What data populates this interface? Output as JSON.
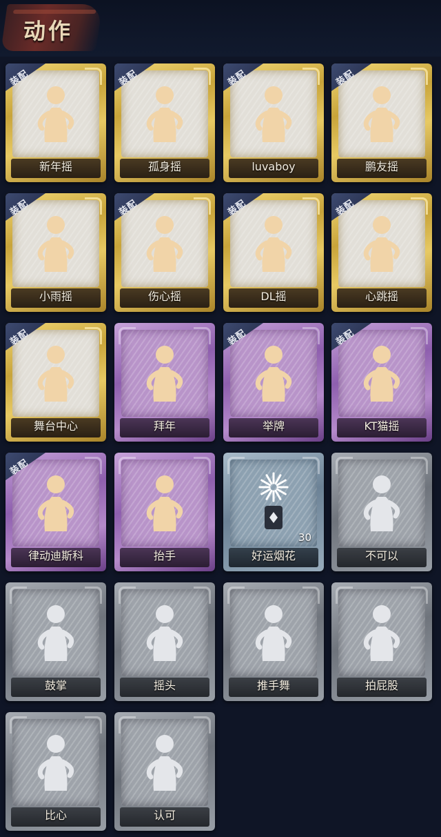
{
  "header": {
    "title": "动作"
  },
  "equip_label": "装配",
  "cards": [
    {
      "label": "新年摇",
      "style": "gold",
      "equipped": true,
      "icon": "new-year-shake-icon"
    },
    {
      "label": "孤身摇",
      "style": "gold",
      "equipped": true,
      "icon": "solo-shake-icon"
    },
    {
      "label": "luvaboy",
      "style": "gold",
      "equipped": true,
      "icon": "luvaboy-icon"
    },
    {
      "label": "鹏友摇",
      "style": "gold",
      "equipped": true,
      "icon": "friend-shake-icon"
    },
    {
      "label": "小雨摇",
      "style": "gold",
      "equipped": true,
      "icon": "light-rain-shake-icon"
    },
    {
      "label": "伤心摇",
      "style": "gold",
      "equipped": true,
      "icon": "heart-hands-icon"
    },
    {
      "label": "DL摇",
      "style": "gold",
      "equipped": true,
      "icon": "dl-shake-icon"
    },
    {
      "label": "心跳摇",
      "style": "gold",
      "equipped": true,
      "icon": "heartbeat-shake-icon"
    },
    {
      "label": "舞台中心",
      "style": "gold",
      "equipped": true,
      "icon": "stage-center-icon"
    },
    {
      "label": "拜年",
      "style": "purple",
      "equipped": false,
      "icon": "new-year-greeting-icon"
    },
    {
      "label": "举牌",
      "style": "purple",
      "equipped": true,
      "icon": "hold-sign-icon"
    },
    {
      "label": "KT猫摇",
      "style": "purple",
      "equipped": true,
      "icon": "kt-cat-shake-icon"
    },
    {
      "label": "律动迪斯科",
      "style": "purple",
      "equipped": true,
      "icon": "rhythm-disco-icon"
    },
    {
      "label": "抬手",
      "style": "purple",
      "equipped": false,
      "icon": "raise-hand-icon"
    },
    {
      "label": "好运烟花",
      "style": "blue",
      "equipped": false,
      "icon": "firework-icon",
      "count": "30"
    },
    {
      "label": "不可以",
      "style": "gray",
      "equipped": false,
      "icon": "finger-wag-icon"
    },
    {
      "label": "鼓掌",
      "style": "gray",
      "equipped": false,
      "icon": "clap-icon"
    },
    {
      "label": "摇头",
      "style": "gray",
      "equipped": false,
      "icon": "shake-head-icon"
    },
    {
      "label": "推手舞",
      "style": "gray",
      "equipped": false,
      "icon": "push-hand-dance-icon"
    },
    {
      "label": "拍屁股",
      "style": "gray",
      "equipped": false,
      "icon": "slap-butt-icon"
    },
    {
      "label": "比心",
      "style": "gray",
      "equipped": false,
      "icon": "finger-heart-icon"
    },
    {
      "label": "认可",
      "style": "gray",
      "equipped": false,
      "icon": "thumbs-up-icon"
    }
  ],
  "colors": {
    "background": "#0f1526",
    "gold": "#d9b84f",
    "purple": "#9c6cba",
    "blue": "#7f95a8",
    "gray": "#8a8f96"
  }
}
